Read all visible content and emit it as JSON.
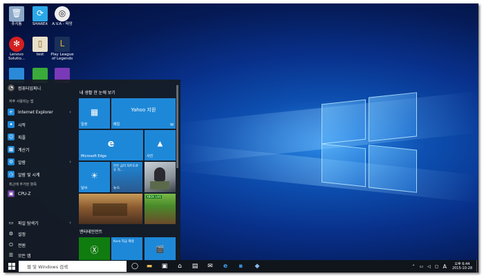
{
  "desktop": {
    "icons": [
      {
        "label": "휴지통",
        "icon": "recycle-bin-icon",
        "color": "#7aa0c8"
      },
      {
        "label": "SHAREit",
        "icon": "shareit-icon",
        "color": "#2aa8e8"
      },
      {
        "label": "A.V.A - 파망",
        "icon": "ava-icon",
        "color": "#222222"
      },
      {
        "label": "Lenovo Solutio...",
        "icon": "lenovo-icon",
        "color": "#d42020"
      },
      {
        "label": "test",
        "icon": "file-icon",
        "color": "#e8e0c8"
      },
      {
        "label": "Play League of Legends",
        "icon": "lol-icon",
        "color": "#1a3058"
      }
    ]
  },
  "start_menu": {
    "user": "컴퓨터입퍼니",
    "most_used_header": "자주 사용되는 앱",
    "most_used": [
      {
        "label": "Internet Explorer",
        "icon": "ie-icon",
        "color": "#1e88d8",
        "chevron": true
      },
      {
        "label": "시작",
        "icon": "get-started-icon",
        "color": "#1e88d8",
        "chevron": false
      },
      {
        "label": "피플",
        "icon": "people-icon",
        "color": "#1e88d8",
        "chevron": false
      },
      {
        "label": "계산기",
        "icon": "calculator-icon",
        "color": "#1e88d8",
        "chevron": false
      },
      {
        "label": "알람",
        "icon": "gear-icon",
        "color": "#1e88d8",
        "chevron": true
      },
      {
        "label": "알람 및 시계",
        "icon": "alarm-icon",
        "color": "#1e88d8",
        "chevron": false
      }
    ],
    "recent_header": "최근에 추가된 항목",
    "recent": [
      {
        "label": "CPU-Z",
        "icon": "cpuz-icon",
        "color": "#6a3a9a"
      }
    ],
    "bottom": [
      {
        "label": "파일 탐색기",
        "icon": "folder-icon",
        "chevron": true
      },
      {
        "label": "설정",
        "icon": "settings-icon",
        "chevron": false
      },
      {
        "label": "전원",
        "icon": "power-icon",
        "chevron": false
      },
      {
        "label": "모든 앱",
        "icon": "list-icon",
        "chevron": false
      }
    ],
    "tiles_header": "내 생활 한 눈에 보기",
    "tiles": [
      {
        "name": "tile-calendar",
        "label": "일정",
        "glyph": "▦",
        "color": "#1e88d8"
      },
      {
        "name": "tile-mail",
        "label": "메일",
        "top": "Yahoo 지원",
        "glyph": "✉",
        "color": "#1e88d8"
      },
      {
        "name": "tile-edge",
        "label": "Microsoft Edge",
        "glyph": "e",
        "color": "#1e88d8"
      },
      {
        "name": "tile-photos",
        "label": "사진",
        "glyph": "▲",
        "color": "#1e88d8"
      },
      {
        "name": "tile-weather",
        "label": "날씨",
        "glyph": "☀",
        "color": "#1e88d8"
      },
      {
        "name": "tile-news",
        "label": "뉴스",
        "top": "한은 금리 차트도로 유 지... ",
        "glyph": "",
        "color": "#2a6aa8"
      },
      {
        "name": "tile-people-photo",
        "label": "",
        "glyph": "",
        "color": "#b8c0c8"
      },
      {
        "name": "tile-game",
        "label": "",
        "glyph": "",
        "color": "#7a4a28"
      },
      {
        "name": "tile-minecraft",
        "label": "",
        "top": "XBOX LIVE",
        "glyph": "",
        "color": "#3a8a3a"
      }
    ],
    "play_header": "엔터테인먼트",
    "play_tiles": [
      {
        "name": "tile-xbox",
        "label": "",
        "glyph": "Ⓧ",
        "color": "#107c10"
      },
      {
        "name": "tile-groove",
        "label": "",
        "top": "Kara 지금 재생",
        "glyph": "",
        "color": "#1e88d8"
      },
      {
        "name": "tile-movies",
        "label": "",
        "glyph": "🎬",
        "color": "#1e88d8"
      }
    ]
  },
  "taskbar": {
    "search_placeholder": "웹 및 Windows 검색",
    "ime": "A",
    "clock_time": "오후 6:44",
    "clock_date": "2015-10-28"
  }
}
